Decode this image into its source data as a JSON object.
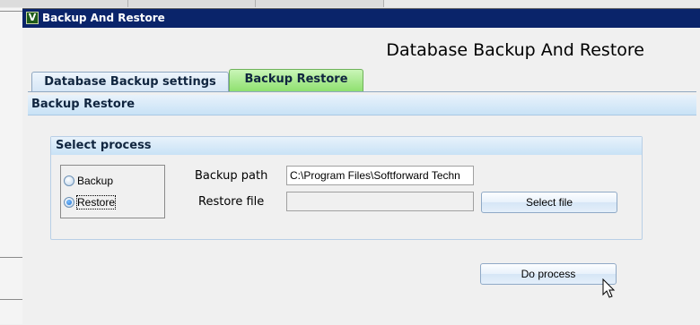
{
  "window": {
    "title": "Backup And Restore",
    "icon_letter": "V"
  },
  "header": {
    "title": "Database Backup And Restore"
  },
  "tabs": [
    {
      "label": "Database Backup settings",
      "active": false
    },
    {
      "label": "Backup Restore",
      "active": true
    }
  ],
  "section": {
    "title": "Backup Restore"
  },
  "group": {
    "title": "Select process",
    "options": [
      {
        "label": "Backup",
        "checked": false
      },
      {
        "label": "Restore",
        "checked": true
      }
    ]
  },
  "fields": {
    "backup_path_label": "Backup path",
    "backup_path_value": "C:\\Program Files\\Softforward Techn",
    "restore_file_label": "Restore file",
    "restore_file_value": ""
  },
  "buttons": {
    "select_file": "Select file",
    "do_process": "Do process"
  },
  "colors": {
    "titlebar": "#0a246a",
    "active_tab": "#8fe06f",
    "section_head": "#c8e2f6"
  },
  "icons": {
    "app": "app-icon",
    "cursor": "mouse-pointer-icon"
  }
}
